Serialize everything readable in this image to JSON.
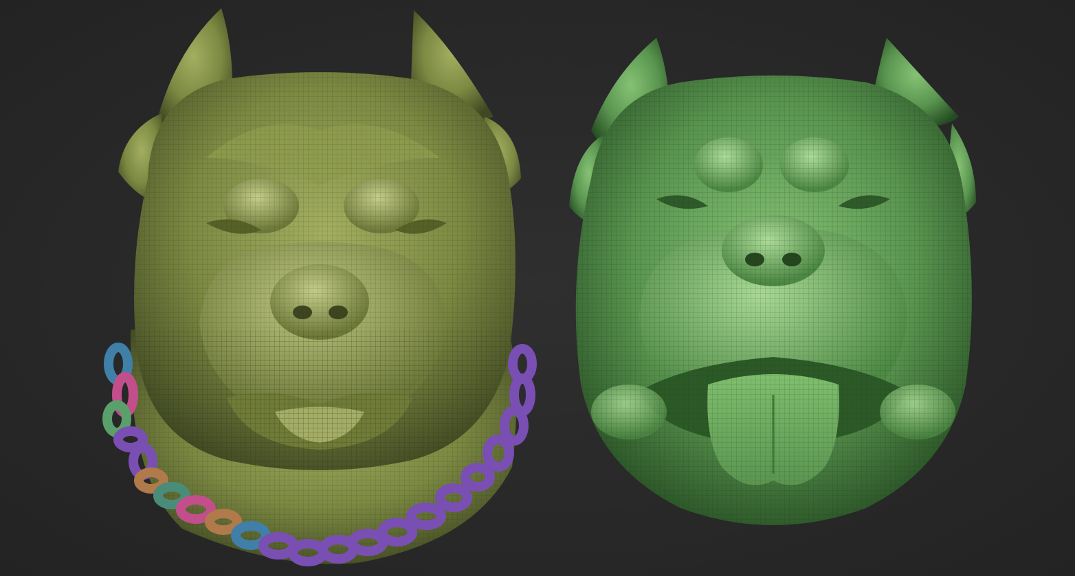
{
  "scene": {
    "background_color": "#2a2a2a",
    "models": [
      {
        "name": "dog-head-with-chain",
        "material_color": "#7e8c44",
        "shadow_color": "#3b4320",
        "highlight_color": "#b9c27c",
        "chain_colors": [
          "#7a4fb3",
          "#4a8c7a",
          "#c24f8c",
          "#3f7fa8",
          "#b07a4a",
          "#5aa06a"
        ]
      },
      {
        "name": "dog-head-tongue-out",
        "material_color": "#5f9a52",
        "shadow_color": "#264a22",
        "highlight_color": "#9fd08c"
      }
    ]
  }
}
